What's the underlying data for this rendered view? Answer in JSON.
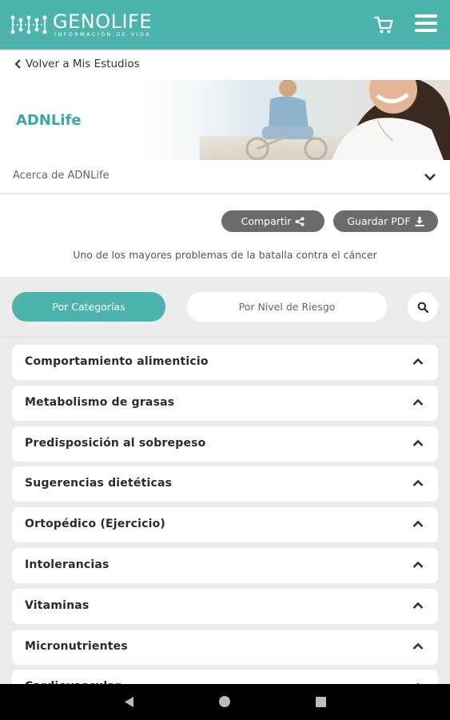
{
  "header": {
    "logo_name": "GENOLIFE",
    "logo_sub": "INFORMACIÓN DE VIDA",
    "brand_color": "#4db3ad",
    "cart_icon": "cart-icon",
    "menu_icon": "hamburger-menu-icon"
  },
  "back": {
    "label": "Volver a Mis Estudios"
  },
  "hero": {
    "title": "ADNLife"
  },
  "about": {
    "label": "Acerca de ADNLife"
  },
  "actions": {
    "share_label": "Compartir",
    "pdf_label": "Guardar PDF",
    "tagline": "Uno de los mayores problemas de la batalla contra el cáncer"
  },
  "filter": {
    "tab_categories": "Por Categorías",
    "tab_risk": "Por Nivel de Riesgo"
  },
  "categories": [
    "Comportamiento alimenticio",
    "Metabolismo de grasas",
    "Predisposición al sobrepeso",
    "Sugerencias dietéticas",
    "Ortopédico (Ejercicio)",
    "Intolerancias",
    "Vitaminas",
    "Micronutrientes",
    "Cardiovascular"
  ]
}
